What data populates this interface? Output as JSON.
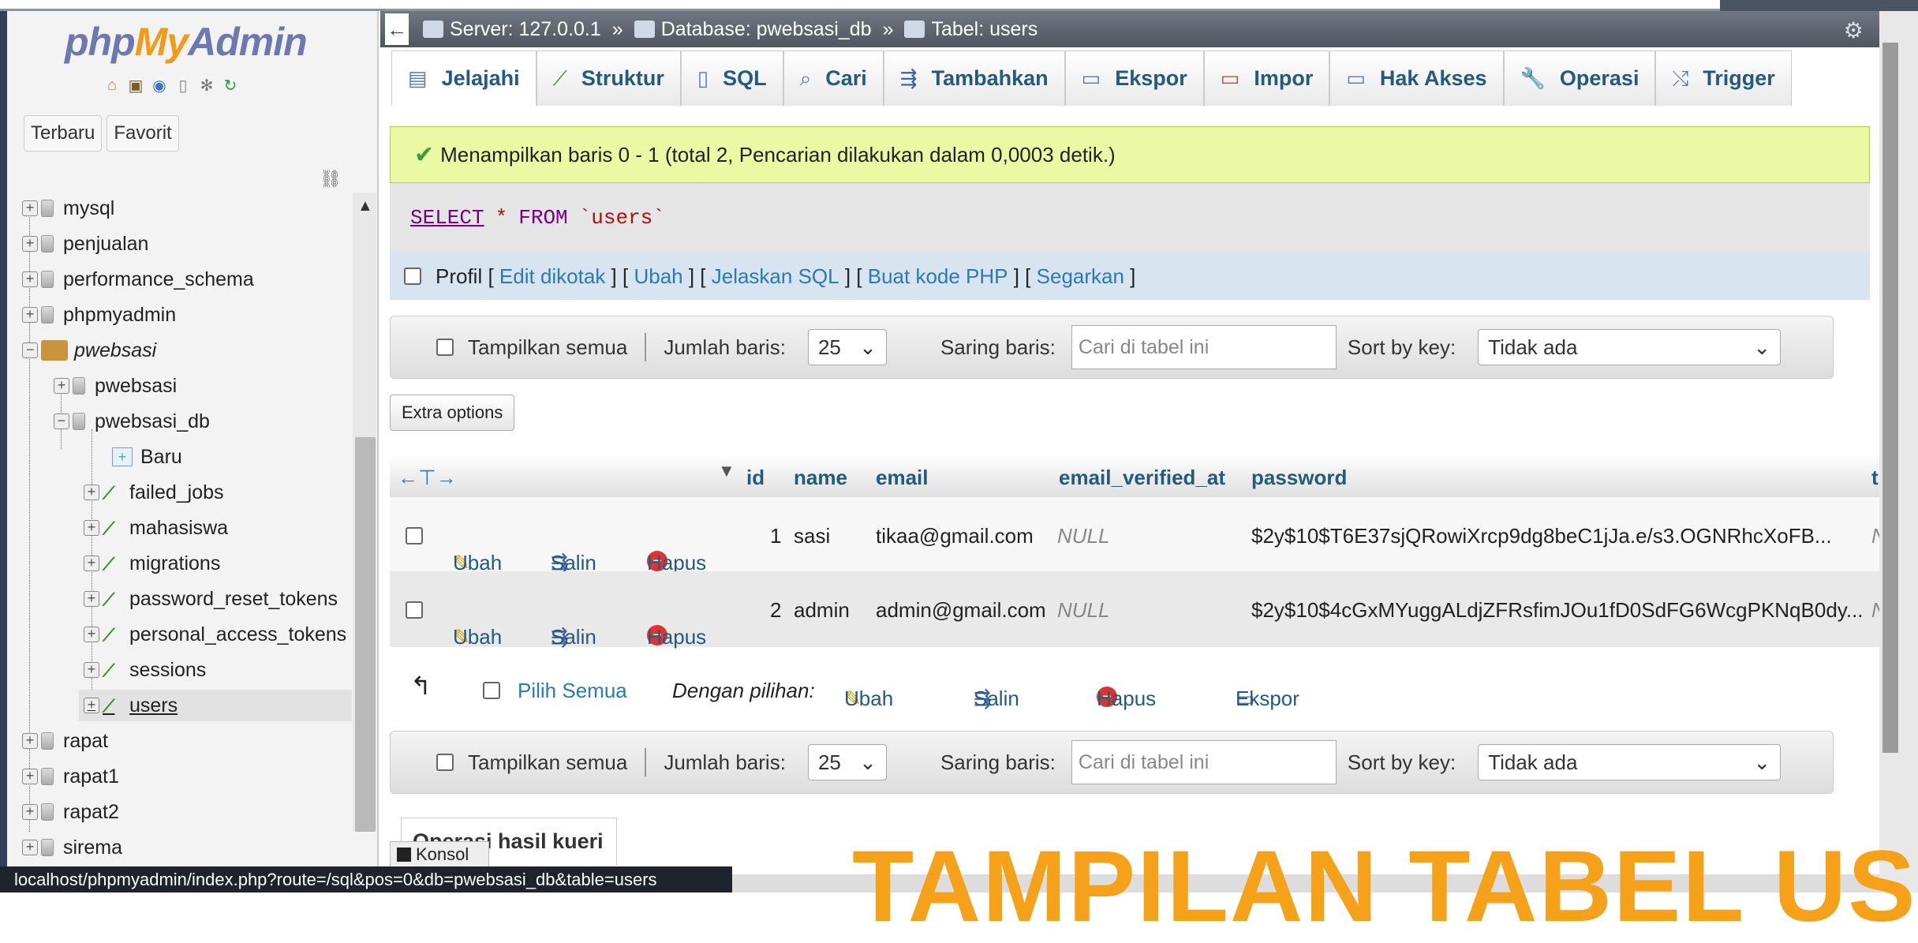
{
  "logo": {
    "php": "php",
    "my": "My",
    "admin": "Admin"
  },
  "nav": {
    "tabs": [
      "Terbaru",
      "Favorit"
    ],
    "tree": [
      {
        "label": "mysql"
      },
      {
        "label": "penjualan"
      },
      {
        "label": "performance_schema"
      },
      {
        "label": "phpmyadmin"
      },
      {
        "label": "pwebsasi"
      },
      {
        "label": "pwebsasi"
      },
      {
        "label": "pwebsasi_db"
      },
      {
        "label": "Baru"
      },
      {
        "label": "failed_jobs"
      },
      {
        "label": "mahasiswa"
      },
      {
        "label": "migrations"
      },
      {
        "label": "password_reset_tokens"
      },
      {
        "label": "personal_access_tokens"
      },
      {
        "label": "sessions"
      },
      {
        "label": "users"
      },
      {
        "label": "rapat"
      },
      {
        "label": "rapat1"
      },
      {
        "label": "rapat2"
      },
      {
        "label": "sirema"
      }
    ]
  },
  "breadcrumb": {
    "server": "Server: 127.0.0.1",
    "database": "Database: pwebsasi_db",
    "table": "Tabel: users",
    "sep": "»"
  },
  "menu": [
    "Jelajahi",
    "Struktur",
    "SQL",
    "Cari",
    "Tambahkan",
    "Ekspor",
    "Impor",
    "Hak Akses",
    "Operasi",
    "Trigger"
  ],
  "success_message": "Menampilkan baris 0 - 1 (total 2, Pencarian dilakukan dalam 0,0003 detik.)",
  "sql": {
    "select": "SELECT",
    "star": "*",
    "from": "FROM",
    "table": "`users`"
  },
  "profil": {
    "label": "Profil",
    "links": [
      "Edit dikotak",
      "Ubah",
      "Jelaskan SQL",
      "Buat kode PHP",
      "Segarkan"
    ]
  },
  "toolbar": {
    "show_all": "Tampilkan semua",
    "rows_label": "Jumlah baris:",
    "rows_value": "25",
    "filter_label": "Saring baris:",
    "filter_placeholder": "Cari di tabel ini",
    "sort_label": "Sort by key:",
    "sort_value": "Tidak ada"
  },
  "extra_options": "Extra options",
  "table": {
    "columns": [
      "id",
      "name",
      "email",
      "email_verified_at",
      "password",
      "t"
    ],
    "actions": {
      "edit": "Ubah",
      "copy": "Salin",
      "delete": "Hapus"
    },
    "rows": [
      {
        "id": "1",
        "name": "sasi",
        "email": "tikaa@gmail.com",
        "verified": "NULL",
        "password": "$2y$10$T6E37sjQRowiXrcp9dg8beC1jJa.e/s3.OGNRhcXoFB...",
        "tail": "N"
      },
      {
        "id": "2",
        "name": "admin",
        "email": "admin@gmail.com",
        "verified": "NULL",
        "password": "$2y$10$4cGxMYuggALdjZFRsfimJOu1fD0SdFG6WcgPKNqB0dy...",
        "tail": "N"
      }
    ]
  },
  "bulk": {
    "select_all": "Pilih Semua",
    "with_selected": "Dengan pilihan:",
    "edit": "Ubah",
    "copy": "Salin",
    "delete": "Hapus",
    "export": "Ekspor"
  },
  "query_ops": "Operasi hasil kueri",
  "console": "Konsol",
  "status_url": "localhost/phpmyadmin/index.php?route=/sql&pos=0&db=pwebsasi_db&table=users",
  "overlay_text": "TAMPILAN TABEL USE",
  "colors": {
    "accent": "#235a81",
    "success_bg": "#ebf8a4",
    "overlay": "#f5a21a"
  }
}
